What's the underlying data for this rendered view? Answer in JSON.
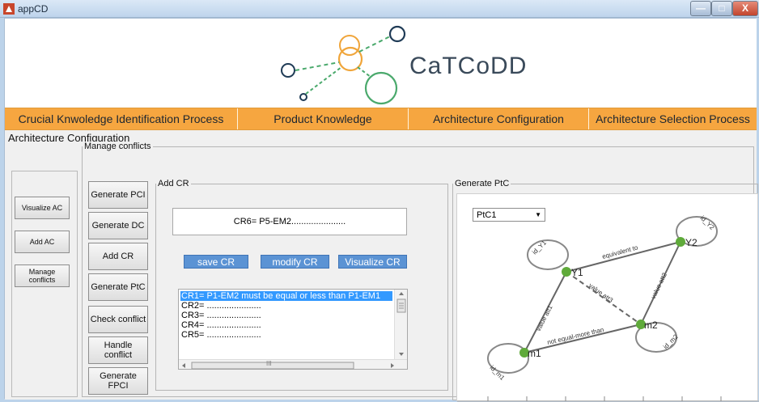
{
  "window": {
    "title": "appCD",
    "min_glyph": "—",
    "max_glyph": "□",
    "close_glyph": "X"
  },
  "brand": {
    "name": "CaTCoDD",
    "logo_colors": [
      "#1f3b56",
      "#4aa96c",
      "#f0a53a"
    ]
  },
  "menu": {
    "items": [
      {
        "label": "Crucial Knwoledge Identification Process"
      },
      {
        "label": "Product Knowledge"
      },
      {
        "label": "Architecture Configuration"
      },
      {
        "label": "Architecture Selection Process"
      }
    ],
    "color": "#f6a640"
  },
  "section": {
    "title": "Architecture Configuration"
  },
  "left_panel": {
    "buttons": [
      {
        "label": "Visualize AC"
      },
      {
        "label": "Add AC"
      },
      {
        "label": "Manage conflicts"
      }
    ]
  },
  "manage_conflicts": {
    "legend": "Manage conflicts",
    "buttons": [
      {
        "label": "Generate PCI"
      },
      {
        "label": "Generate DC"
      },
      {
        "label": "Add CR"
      },
      {
        "label": "Generate PtC"
      },
      {
        "label": "Check conflict"
      },
      {
        "label": "Handle conflict"
      },
      {
        "label": "Generate FPCI"
      }
    ]
  },
  "add_cr": {
    "legend": "Add CR",
    "field_value": "CR6= P5-EM2......................",
    "buttons": [
      {
        "label": "save CR"
      },
      {
        "label": "modify CR"
      },
      {
        "label": "Visualize CR"
      }
    ],
    "list": [
      "CR1= P1-EM2 must be equal or less than P1-EM1",
      "CR2= ......................",
      "CR3= ......................",
      "CR4= ......................",
      "CR5= ......................"
    ],
    "selected_index": 0,
    "scroll_thumb_glyph": "III"
  },
  "generate_ptc": {
    "legend": "Generate PtC",
    "selected": "PtC1",
    "graph": {
      "nodes": [
        "Y1",
        "Y2",
        "m1",
        "m2"
      ],
      "loop_labels": [
        "id_Y1",
        "id_Y2",
        "id_m1",
        "id_m2"
      ],
      "edge_labels": [
        "equivalent to",
        "value att1",
        "value att2",
        "value att3",
        "not equal-more than"
      ],
      "node_color": "#5faa3a"
    }
  }
}
